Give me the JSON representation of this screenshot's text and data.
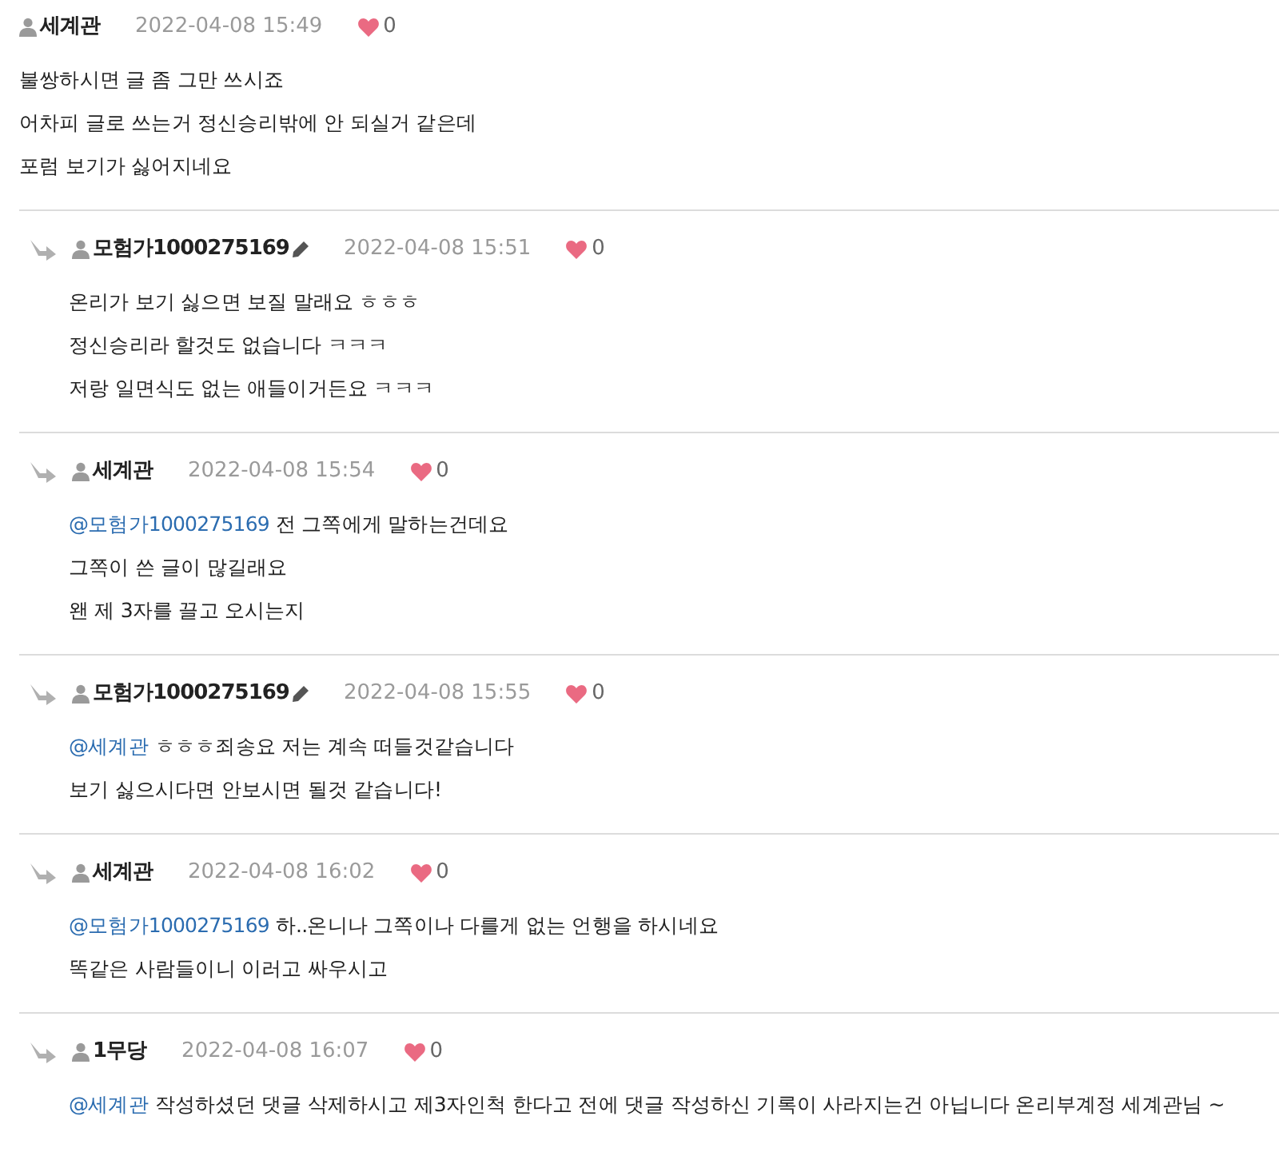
{
  "comments": [
    {
      "kind": "top",
      "author": "세계관",
      "edited": false,
      "time": "2022-04-08 15:49",
      "likes": "0",
      "lines": [
        {
          "text": "불쌍하시면 글 좀 그만 쓰시죠"
        },
        {
          "text": "어차피 글로 쓰는거 정신승리밖에 안 되실거 같은데"
        },
        {
          "text": "포럼 보기가 싫어지네요"
        }
      ]
    },
    {
      "kind": "reply",
      "author": "모험가1000275169",
      "edited": true,
      "time": "2022-04-08 15:51",
      "likes": "0",
      "lines": [
        {
          "text": "온리가 보기 싫으면 보질 말래요 ㅎㅎㅎ"
        },
        {
          "text": "정신승리라 할것도 없습니다 ㅋㅋㅋ"
        },
        {
          "text": "저랑 일면식도 없는 애들이거든요 ㅋㅋㅋ"
        }
      ]
    },
    {
      "kind": "reply",
      "author": "세계관",
      "edited": false,
      "time": "2022-04-08 15:54",
      "likes": "0",
      "lines": [
        {
          "mention": "@모험가1000275169",
          "text": "전 그쪽에게 말하는건데요"
        },
        {
          "text": "그쪽이 쓴 글이 많길래요"
        },
        {
          "text": "왠 제 3자를 끌고 오시는지"
        }
      ]
    },
    {
      "kind": "reply",
      "author": "모험가1000275169",
      "edited": true,
      "time": "2022-04-08 15:55",
      "likes": "0",
      "lines": [
        {
          "mention": "@세계관",
          "text": "ㅎㅎㅎ죄송요 저는 계속 떠들것같습니다"
        },
        {
          "text": "보기 싫으시다면 안보시면 될것 같습니다!"
        }
      ]
    },
    {
      "kind": "reply",
      "author": "세계관",
      "edited": false,
      "time": "2022-04-08 16:02",
      "likes": "0",
      "lines": [
        {
          "mention": "@모험가1000275169",
          "text": "하..온니나 그쪽이나 다를게 없는 언행을 하시네요"
        },
        {
          "text": "똑같은 사람들이니 이러고 싸우시고"
        }
      ]
    },
    {
      "kind": "reply",
      "author": "1무당",
      "edited": false,
      "time": "2022-04-08 16:07",
      "likes": "0",
      "lines": [
        {
          "mention": "@세계관",
          "text": "작성하셨던 댓글 삭제하시고 제3자인척 한다고 전에 댓글 작성하신 기록이 사라지는건 아닙니다 온리부계정 세계관님 ~"
        }
      ]
    }
  ]
}
